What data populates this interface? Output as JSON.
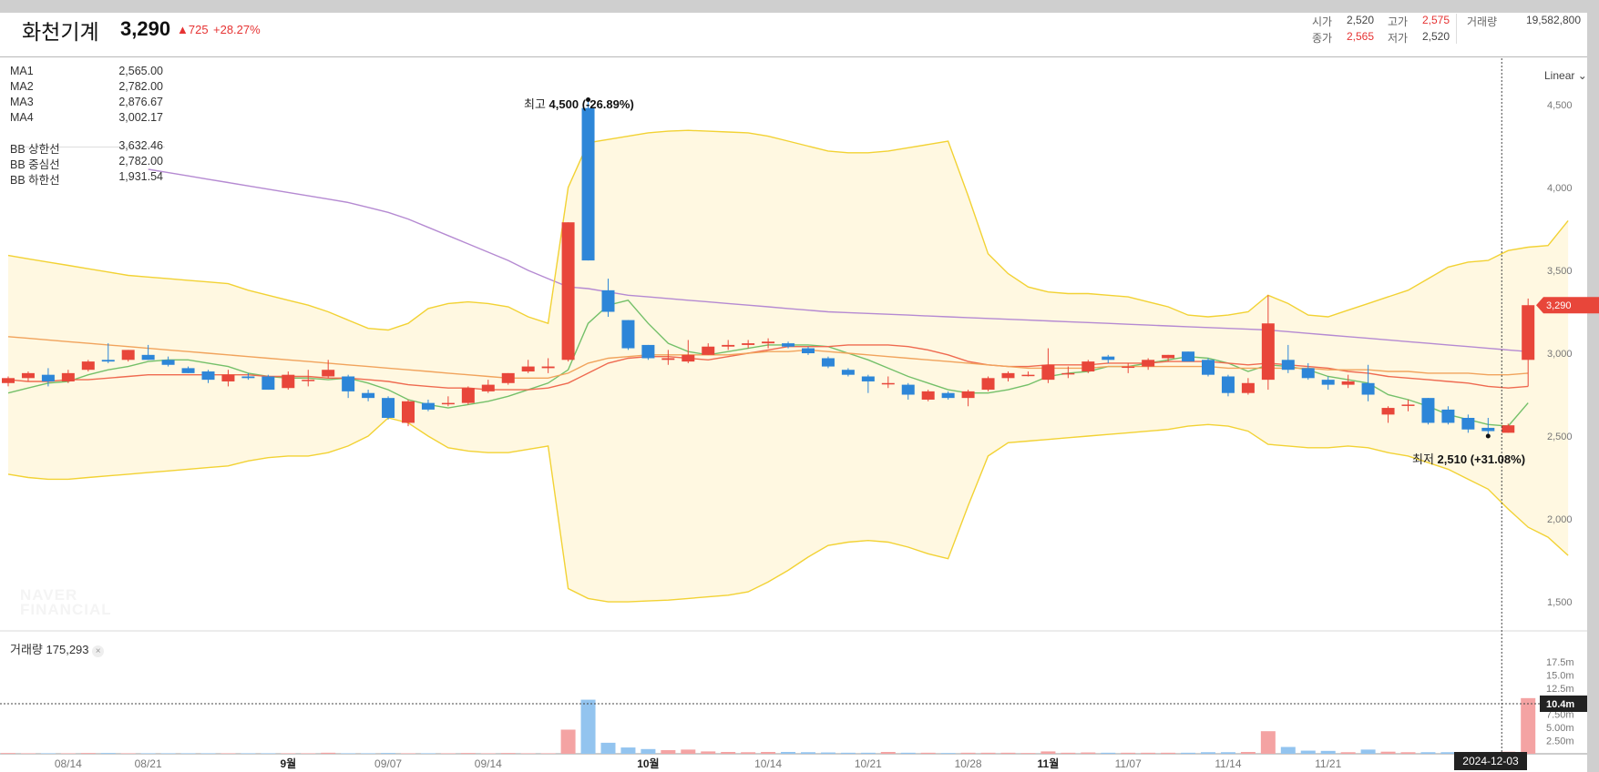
{
  "header": {
    "stock_name": "화천기계",
    "price": "3,290",
    "change": "▲725",
    "change_rate": "+28.27%",
    "open_label": "시가",
    "open": "2,520",
    "high_label": "고가",
    "high": "2,575",
    "volume_label": "거래량",
    "volume": "19,582,800",
    "close_label": "종가",
    "close": "2,565",
    "low_label": "저가",
    "low": "2,520"
  },
  "indicators": [
    {
      "label": "MA1",
      "value": "2,565.00",
      "color": "#74c069"
    },
    {
      "label": "MA2",
      "value": "2,782.00",
      "color": "#ef6a50"
    },
    {
      "label": "MA3",
      "value": "2,876.67",
      "color": "#f1a35c"
    },
    {
      "label": "MA4",
      "value": "3,002.17",
      "color": "#b58ad2"
    },
    {
      "label": "BB 상한선",
      "value": "3,632.46",
      "color": "#e8c43c"
    },
    {
      "label": "BB 중심선",
      "value": "2,782.00",
      "color": "#e8c43c"
    },
    {
      "label": "BB 하한선",
      "value": "1,931.54",
      "color": "#e8c43c"
    }
  ],
  "annotations": {
    "high_label": "최고",
    "high_value": "4,500 (-26.89%)",
    "low_label": "최저",
    "low_value": "2,510 (+31.08%)"
  },
  "scale_mode": "Linear",
  "current_price_badge": "3,290",
  "volume_panel": {
    "label": "거래량",
    "value": "175,293",
    "crosshair_badge": "10.4m"
  },
  "crosshair_date": "2024-12-03",
  "watermark": {
    "line1": "NAVER",
    "line2": "FINANCIAL"
  },
  "colors": {
    "up": "#e8463a",
    "down": "#2d86d8",
    "vol_up": "#f4a3a3",
    "vol_down": "#93c4ef",
    "bb_fill": "#fff8e1"
  },
  "chart_data": {
    "type": "candlestick",
    "y_axis": {
      "ticks": [
        4500,
        4000,
        3500,
        3000,
        2500,
        2000,
        1500
      ],
      "tick_labels": [
        "4,500",
        "4,000",
        "3,500",
        "3,000",
        "2,500",
        "2,000",
        "1,500"
      ],
      "range": [
        1330,
        4780
      ]
    },
    "volume_axis": {
      "tick_labels": [
        "17.5m",
        "15.0m",
        "12.5m",
        "7.50m",
        "5.00m",
        "2.50m"
      ],
      "ticks_m": [
        17.5,
        15.0,
        12.5,
        7.5,
        5.0,
        2.5
      ],
      "range_m": [
        0,
        20.8
      ]
    },
    "x_axis": {
      "labels": [
        "08/14",
        "08/21",
        "9월",
        "09/07",
        "09/14",
        "10월",
        "10/14",
        "10/21",
        "10/28",
        "11월",
        "11/07",
        "11/14",
        "11/21"
      ],
      "label_index": [
        3,
        7,
        14,
        19,
        24,
        32,
        38,
        43,
        48,
        52,
        56,
        61,
        66
      ],
      "bold_labels": [
        "9월",
        "10월",
        "11월"
      ]
    },
    "candles": [
      {
        "o": 2820,
        "h": 2860,
        "l": 2800,
        "c": 2850
      },
      {
        "o": 2850,
        "h": 2890,
        "l": 2830,
        "c": 2880
      },
      {
        "o": 2870,
        "h": 2910,
        "l": 2800,
        "c": 2830
      },
      {
        "o": 2830,
        "h": 2900,
        "l": 2820,
        "c": 2880
      },
      {
        "o": 2900,
        "h": 2960,
        "l": 2890,
        "c": 2950
      },
      {
        "o": 2960,
        "h": 3060,
        "l": 2940,
        "c": 2950
      },
      {
        "o": 2960,
        "h": 3020,
        "l": 2950,
        "c": 3020
      },
      {
        "o": 2990,
        "h": 3050,
        "l": 2960,
        "c": 2960
      },
      {
        "o": 2960,
        "h": 2980,
        "l": 2920,
        "c": 2930
      },
      {
        "o": 2910,
        "h": 2920,
        "l": 2880,
        "c": 2880
      },
      {
        "o": 2890,
        "h": 2900,
        "l": 2820,
        "c": 2840
      },
      {
        "o": 2830,
        "h": 2900,
        "l": 2800,
        "c": 2870
      },
      {
        "o": 2860,
        "h": 2880,
        "l": 2840,
        "c": 2850
      },
      {
        "o": 2860,
        "h": 2870,
        "l": 2780,
        "c": 2780
      },
      {
        "o": 2790,
        "h": 2890,
        "l": 2780,
        "c": 2870
      },
      {
        "o": 2840,
        "h": 2900,
        "l": 2800,
        "c": 2840
      },
      {
        "o": 2860,
        "h": 2960,
        "l": 2850,
        "c": 2900
      },
      {
        "o": 2860,
        "h": 2870,
        "l": 2730,
        "c": 2770
      },
      {
        "o": 2760,
        "h": 2780,
        "l": 2710,
        "c": 2730
      },
      {
        "o": 2730,
        "h": 2740,
        "l": 2600,
        "c": 2610
      },
      {
        "o": 2580,
        "h": 2720,
        "l": 2560,
        "c": 2710
      },
      {
        "o": 2700,
        "h": 2720,
        "l": 2650,
        "c": 2660
      },
      {
        "o": 2700,
        "h": 2740,
        "l": 2680,
        "c": 2700
      },
      {
        "o": 2700,
        "h": 2800,
        "l": 2690,
        "c": 2790
      },
      {
        "o": 2770,
        "h": 2840,
        "l": 2760,
        "c": 2810
      },
      {
        "o": 2820,
        "h": 2880,
        "l": 2810,
        "c": 2880
      },
      {
        "o": 2890,
        "h": 2960,
        "l": 2880,
        "c": 2920
      },
      {
        "o": 2910,
        "h": 2970,
        "l": 2880,
        "c": 2920
      },
      {
        "o": 2960,
        "h": 3790,
        "l": 2950,
        "c": 3790
      },
      {
        "o": 4480,
        "h": 4530,
        "l": 3560,
        "c": 3560
      },
      {
        "o": 3380,
        "h": 3450,
        "l": 3220,
        "c": 3250
      },
      {
        "o": 3200,
        "h": 3200,
        "l": 3020,
        "c": 3030
      },
      {
        "o": 3050,
        "h": 3050,
        "l": 2960,
        "c": 2970
      },
      {
        "o": 2960,
        "h": 3020,
        "l": 2930,
        "c": 2970
      },
      {
        "o": 2950,
        "h": 3080,
        "l": 2940,
        "c": 2990
      },
      {
        "o": 2990,
        "h": 3060,
        "l": 2990,
        "c": 3040
      },
      {
        "o": 3040,
        "h": 3080,
        "l": 3020,
        "c": 3050
      },
      {
        "o": 3050,
        "h": 3080,
        "l": 3030,
        "c": 3060
      },
      {
        "o": 3060,
        "h": 3090,
        "l": 3030,
        "c": 3070
      },
      {
        "o": 3060,
        "h": 3070,
        "l": 3030,
        "c": 3040
      },
      {
        "o": 3030,
        "h": 3040,
        "l": 2990,
        "c": 3000
      },
      {
        "o": 2970,
        "h": 2980,
        "l": 2910,
        "c": 2920
      },
      {
        "o": 2900,
        "h": 2910,
        "l": 2860,
        "c": 2870
      },
      {
        "o": 2860,
        "h": 2870,
        "l": 2760,
        "c": 2830
      },
      {
        "o": 2820,
        "h": 2860,
        "l": 2790,
        "c": 2820
      },
      {
        "o": 2810,
        "h": 2820,
        "l": 2720,
        "c": 2750
      },
      {
        "o": 2720,
        "h": 2780,
        "l": 2710,
        "c": 2770
      },
      {
        "o": 2760,
        "h": 2770,
        "l": 2720,
        "c": 2730
      },
      {
        "o": 2730,
        "h": 2780,
        "l": 2680,
        "c": 2770
      },
      {
        "o": 2780,
        "h": 2860,
        "l": 2770,
        "c": 2850
      },
      {
        "o": 2850,
        "h": 2890,
        "l": 2830,
        "c": 2880
      },
      {
        "o": 2870,
        "h": 2890,
        "l": 2860,
        "c": 2870
      },
      {
        "o": 2840,
        "h": 3030,
        "l": 2820,
        "c": 2930
      },
      {
        "o": 2880,
        "h": 2920,
        "l": 2850,
        "c": 2880
      },
      {
        "o": 2890,
        "h": 2960,
        "l": 2880,
        "c": 2950
      },
      {
        "o": 2980,
        "h": 2990,
        "l": 2940,
        "c": 2960
      },
      {
        "o": 2920,
        "h": 2940,
        "l": 2880,
        "c": 2920
      },
      {
        "o": 2920,
        "h": 2970,
        "l": 2900,
        "c": 2960
      },
      {
        "o": 2970,
        "h": 2990,
        "l": 2950,
        "c": 2990
      },
      {
        "o": 3010,
        "h": 3010,
        "l": 2950,
        "c": 2950
      },
      {
        "o": 2960,
        "h": 2970,
        "l": 2860,
        "c": 2870
      },
      {
        "o": 2860,
        "h": 2870,
        "l": 2740,
        "c": 2760
      },
      {
        "o": 2760,
        "h": 2850,
        "l": 2750,
        "c": 2820
      },
      {
        "o": 2840,
        "h": 3350,
        "l": 2780,
        "c": 3180
      },
      {
        "o": 2960,
        "h": 3050,
        "l": 2880,
        "c": 2900
      },
      {
        "o": 2910,
        "h": 2940,
        "l": 2840,
        "c": 2850
      },
      {
        "o": 2840,
        "h": 2860,
        "l": 2780,
        "c": 2810
      },
      {
        "o": 2810,
        "h": 2870,
        "l": 2790,
        "c": 2830
      },
      {
        "o": 2820,
        "h": 2930,
        "l": 2710,
        "c": 2750
      },
      {
        "o": 2630,
        "h": 2680,
        "l": 2580,
        "c": 2670
      },
      {
        "o": 2690,
        "h": 2720,
        "l": 2650,
        "c": 2690
      },
      {
        "o": 2730,
        "h": 2730,
        "l": 2570,
        "c": 2580
      },
      {
        "o": 2660,
        "h": 2680,
        "l": 2570,
        "c": 2580
      },
      {
        "o": 2610,
        "h": 2630,
        "l": 2520,
        "c": 2540
      },
      {
        "o": 2550,
        "h": 2610,
        "l": 2510,
        "c": 2530
      },
      {
        "o": 2520,
        "h": 2575,
        "l": 2520,
        "c": 2565
      },
      {
        "o": 2960,
        "h": 3330,
        "l": 2800,
        "c": 3290
      }
    ],
    "volume_m": [
      0.15,
      0.1,
      0.1,
      0.1,
      0.15,
      0.15,
      0.1,
      0.1,
      0.1,
      0.1,
      0.1,
      0.1,
      0.1,
      0.1,
      0.1,
      0.1,
      0.2,
      0.1,
      0.1,
      0.15,
      0.1,
      0.1,
      0.1,
      0.15,
      0.1,
      0.15,
      0.1,
      0.1,
      4.6,
      10.3,
      2.1,
      1.2,
      0.9,
      0.7,
      0.8,
      0.45,
      0.35,
      0.3,
      0.35,
      0.35,
      0.3,
      0.25,
      0.2,
      0.2,
      0.35,
      0.2,
      0.2,
      0.15,
      0.2,
      0.2,
      0.2,
      0.15,
      0.45,
      0.2,
      0.25,
      0.2,
      0.2,
      0.2,
      0.2,
      0.2,
      0.3,
      0.3,
      0.35,
      4.3,
      1.3,
      0.6,
      0.55,
      0.3,
      0.8,
      0.4,
      0.3,
      0.3,
      0.3,
      0.3,
      0.35,
      0.4,
      10.6
    ],
    "series": [
      {
        "name": "MA1",
        "values": [
          2760,
          2790,
          2820,
          2830,
          2870,
          2900,
          2920,
          2950,
          2960,
          2960,
          2940,
          2920,
          2880,
          2860,
          2850,
          2850,
          2840,
          2850,
          2820,
          2780,
          2720,
          2690,
          2670,
          2690,
          2710,
          2740,
          2780,
          2820,
          2900,
          3180,
          3290,
          3320,
          3180,
          3060,
          3010,
          2990,
          3010,
          3030,
          3050,
          3050,
          3050,
          3040,
          3000,
          2960,
          2910,
          2860,
          2820,
          2780,
          2760,
          2760,
          2780,
          2810,
          2860,
          2880,
          2890,
          2920,
          2920,
          2940,
          2960,
          2980,
          2970,
          2940,
          2890,
          2930,
          2920,
          2900,
          2860,
          2840,
          2820,
          2750,
          2720,
          2680,
          2630,
          2600,
          2570,
          2560,
          2700
        ]
      },
      {
        "name": "MA2",
        "values": [
          2840,
          2830,
          2830,
          2840,
          2840,
          2850,
          2860,
          2870,
          2870,
          2870,
          2870,
          2870,
          2870,
          2860,
          2860,
          2860,
          2850,
          2850,
          2840,
          2830,
          2810,
          2800,
          2790,
          2790,
          2780,
          2780,
          2780,
          2790,
          2820,
          2880,
          2940,
          2970,
          2980,
          2980,
          2970,
          2960,
          2980,
          3000,
          3020,
          3040,
          3040,
          3040,
          3050,
          3050,
          3050,
          3040,
          3020,
          2990,
          2950,
          2930,
          2920,
          2920,
          2930,
          2930,
          2930,
          2940,
          2940,
          2940,
          2950,
          2950,
          2950,
          2940,
          2930,
          2940,
          2930,
          2920,
          2910,
          2890,
          2880,
          2860,
          2850,
          2840,
          2830,
          2820,
          2800,
          2790,
          2800
        ]
      },
      {
        "name": "MA3",
        "values": [
          3100,
          3090,
          3080,
          3070,
          3060,
          3050,
          3040,
          3030,
          3020,
          3010,
          3000,
          2990,
          2980,
          2970,
          2960,
          2950,
          2940,
          2930,
          2920,
          2910,
          2900,
          2890,
          2880,
          2870,
          2860,
          2850,
          2850,
          2850,
          2880,
          2940,
          2970,
          2980,
          2990,
          2990,
          2990,
          2990,
          2990,
          3000,
          3010,
          3010,
          3020,
          3010,
          3000,
          2990,
          2980,
          2970,
          2960,
          2950,
          2940,
          2930,
          2920,
          2910,
          2910,
          2910,
          2910,
          2920,
          2920,
          2920,
          2920,
          2920,
          2920,
          2910,
          2910,
          2910,
          2910,
          2910,
          2900,
          2900,
          2900,
          2890,
          2890,
          2880,
          2880,
          2880,
          2870,
          2870,
          2880
        ]
      },
      {
        "name": "MA4",
        "values": [
          null,
          null,
          null,
          null,
          null,
          null,
          null,
          4110,
          4090,
          4070,
          4050,
          4030,
          4010,
          3990,
          3970,
          3950,
          3930,
          3910,
          3880,
          3850,
          3810,
          3760,
          3710,
          3660,
          3610,
          3560,
          3500,
          3450,
          3400,
          3390,
          3370,
          3350,
          3340,
          3330,
          3320,
          3310,
          3300,
          3290,
          3280,
          3270,
          3260,
          3250,
          3245,
          3240,
          3235,
          3230,
          3225,
          3220,
          3215,
          3210,
          3205,
          3200,
          3195,
          3190,
          3185,
          3180,
          3175,
          3170,
          3165,
          3160,
          3155,
          3150,
          3145,
          3140,
          3130,
          3120,
          3110,
          3100,
          3090,
          3080,
          3070,
          3060,
          3050,
          3040,
          3030,
          3020,
          3010
        ]
      },
      {
        "name": "BB 상한선",
        "values": [
          3590,
          3570,
          3550,
          3530,
          3510,
          3490,
          3470,
          3460,
          3450,
          3440,
          3430,
          3420,
          3380,
          3350,
          3320,
          3290,
          3250,
          3200,
          3150,
          3140,
          3180,
          3270,
          3300,
          3310,
          3300,
          3280,
          3220,
          3180,
          4000,
          4270,
          4290,
          4310,
          4330,
          4340,
          4345,
          4340,
          4335,
          4330,
          4310,
          4280,
          4250,
          4220,
          4210,
          4210,
          4220,
          4240,
          4260,
          4280,
          3950,
          3600,
          3480,
          3400,
          3370,
          3360,
          3360,
          3350,
          3340,
          3310,
          3280,
          3230,
          3220,
          3230,
          3250,
          3350,
          3300,
          3230,
          3220,
          3260,
          3300,
          3340,
          3380,
          3450,
          3520,
          3550,
          3560,
          3620,
          3640,
          3650,
          3800
        ]
      },
      {
        "name": "BB 하한선",
        "values": [
          2270,
          2250,
          2240,
          2240,
          2250,
          2260,
          2270,
          2280,
          2290,
          2300,
          2310,
          2320,
          2350,
          2370,
          2380,
          2380,
          2400,
          2440,
          2500,
          2610,
          2580,
          2500,
          2430,
          2410,
          2400,
          2400,
          2420,
          2440,
          1580,
          1520,
          1500,
          1500,
          1505,
          1510,
          1520,
          1530,
          1540,
          1560,
          1620,
          1690,
          1770,
          1840,
          1860,
          1870,
          1860,
          1830,
          1790,
          1760,
          2080,
          2380,
          2460,
          2470,
          2480,
          2490,
          2500,
          2510,
          2520,
          2530,
          2540,
          2560,
          2570,
          2560,
          2530,
          2450,
          2440,
          2430,
          2430,
          2440,
          2430,
          2400,
          2380,
          2340,
          2300,
          2240,
          2180,
          2060,
          1950,
          1890,
          1780
        ]
      }
    ]
  }
}
